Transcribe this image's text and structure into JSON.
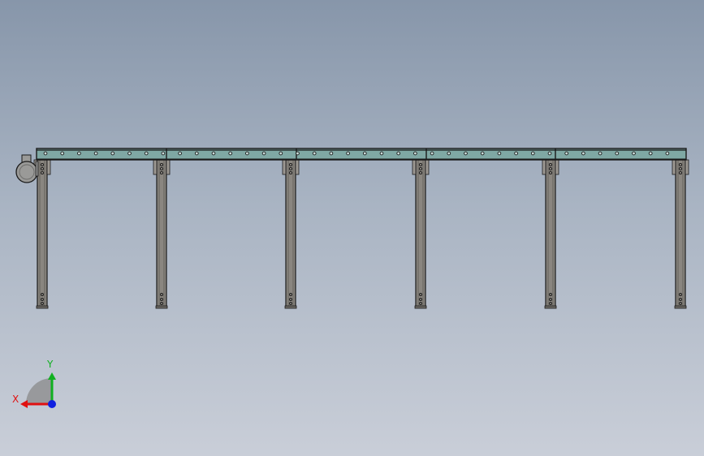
{
  "model": {
    "beam_color": "#7fa8a4",
    "leg_color": "#8a8680",
    "outline_color": "#1a1a1a",
    "motor_color": "#9a9a98",
    "leg_count": 6
  },
  "triad": {
    "x_label": "X",
    "y_label": "Y",
    "x_color": "#e01010",
    "y_color": "#10b020",
    "z_color": "#1020e0",
    "arc_color": "#8a8a8a"
  }
}
